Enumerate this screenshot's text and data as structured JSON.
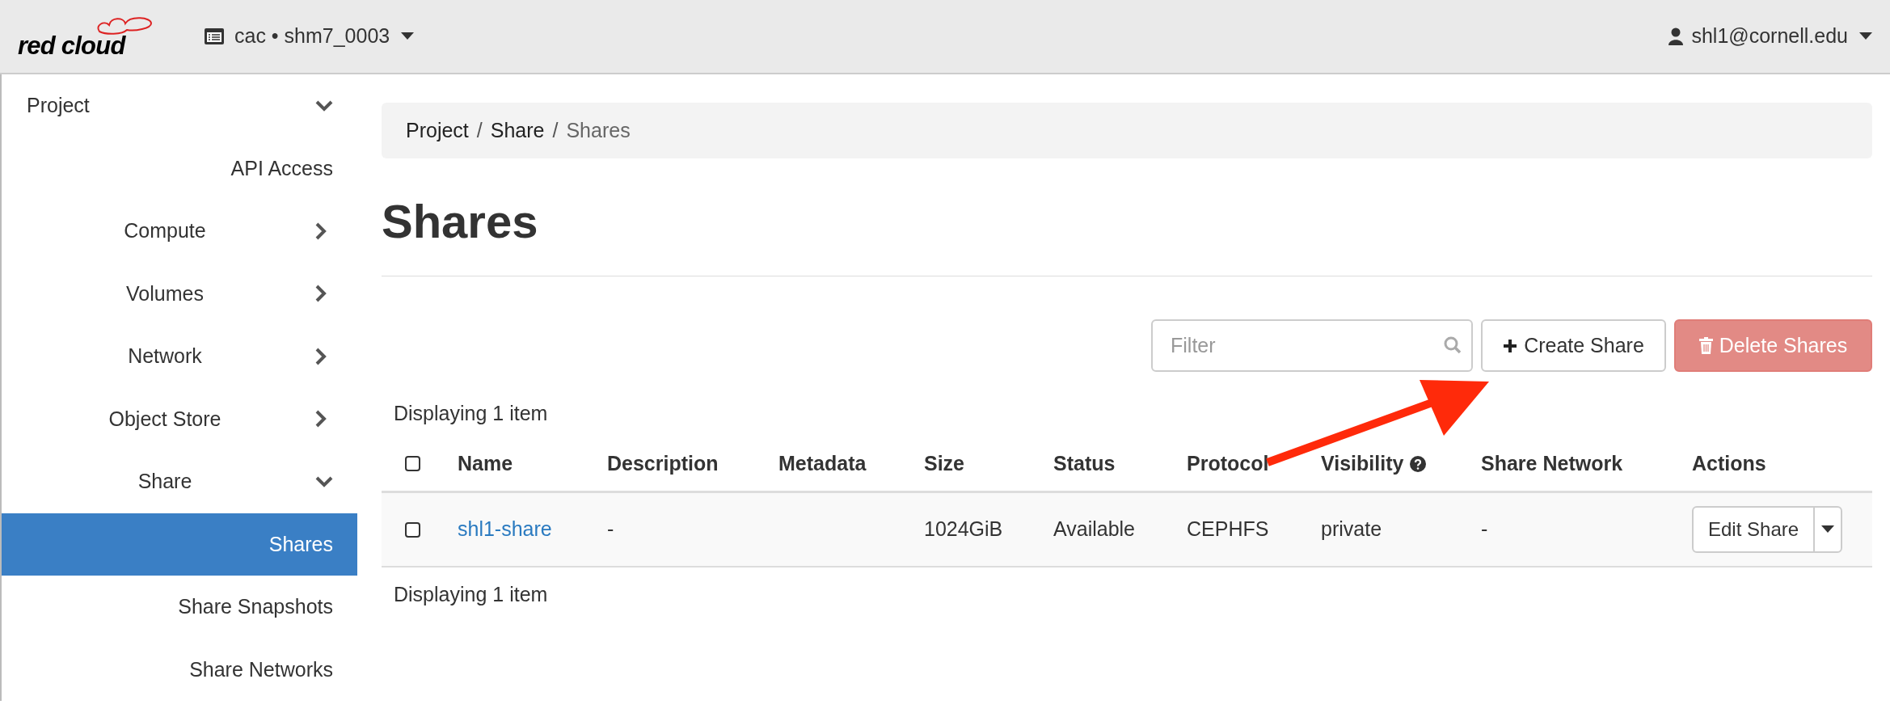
{
  "topbar": {
    "brand": "red cloud",
    "project": "cac • shm7_0003",
    "user": "shl1@cornell.edu"
  },
  "sidebar": {
    "items": [
      {
        "label": "Project",
        "expanded": true,
        "children": [
          {
            "label": "API Access",
            "selected": false
          },
          {
            "label": "Compute",
            "expanded": false
          },
          {
            "label": "Volumes",
            "expanded": false
          },
          {
            "label": "Network",
            "expanded": false
          },
          {
            "label": "Object Store",
            "expanded": false
          },
          {
            "label": "Share",
            "expanded": true,
            "children": [
              {
                "label": "Shares",
                "selected": true
              },
              {
                "label": "Share Snapshots",
                "selected": false
              },
              {
                "label": "Share Networks",
                "selected": false
              }
            ]
          }
        ]
      }
    ]
  },
  "breadcrumb": [
    {
      "label": "Project",
      "separator": "/"
    },
    {
      "label": "Share",
      "separator": "/"
    },
    {
      "label": "Shares"
    }
  ],
  "page_title": "Shares",
  "toolbar": {
    "filter": {
      "placeholder": "Filter"
    },
    "create_button": "Create Share",
    "delete_button": {
      "label": "Delete Shares",
      "disabled": true
    }
  },
  "table": {
    "summary_top": "Displaying 1 item",
    "select_all": {
      "checked": false
    },
    "columns": [
      {
        "label": "Name"
      },
      {
        "label": "Description"
      },
      {
        "label": "Metadata"
      },
      {
        "label": "Size"
      },
      {
        "label": "Status"
      },
      {
        "label": "Protocol"
      },
      {
        "label": "Visibility",
        "help": true
      },
      {
        "label": "Share Network"
      },
      {
        "label": "Actions"
      }
    ],
    "rows": [
      {
        "checked": false,
        "cells": [
          "shl1-share",
          "-",
          "",
          "1024GiB",
          "Available",
          "CEPHFS",
          "private",
          "-"
        ],
        "action": "Edit Share"
      }
    ],
    "summary_bottom": "Displaying 1 item"
  }
}
